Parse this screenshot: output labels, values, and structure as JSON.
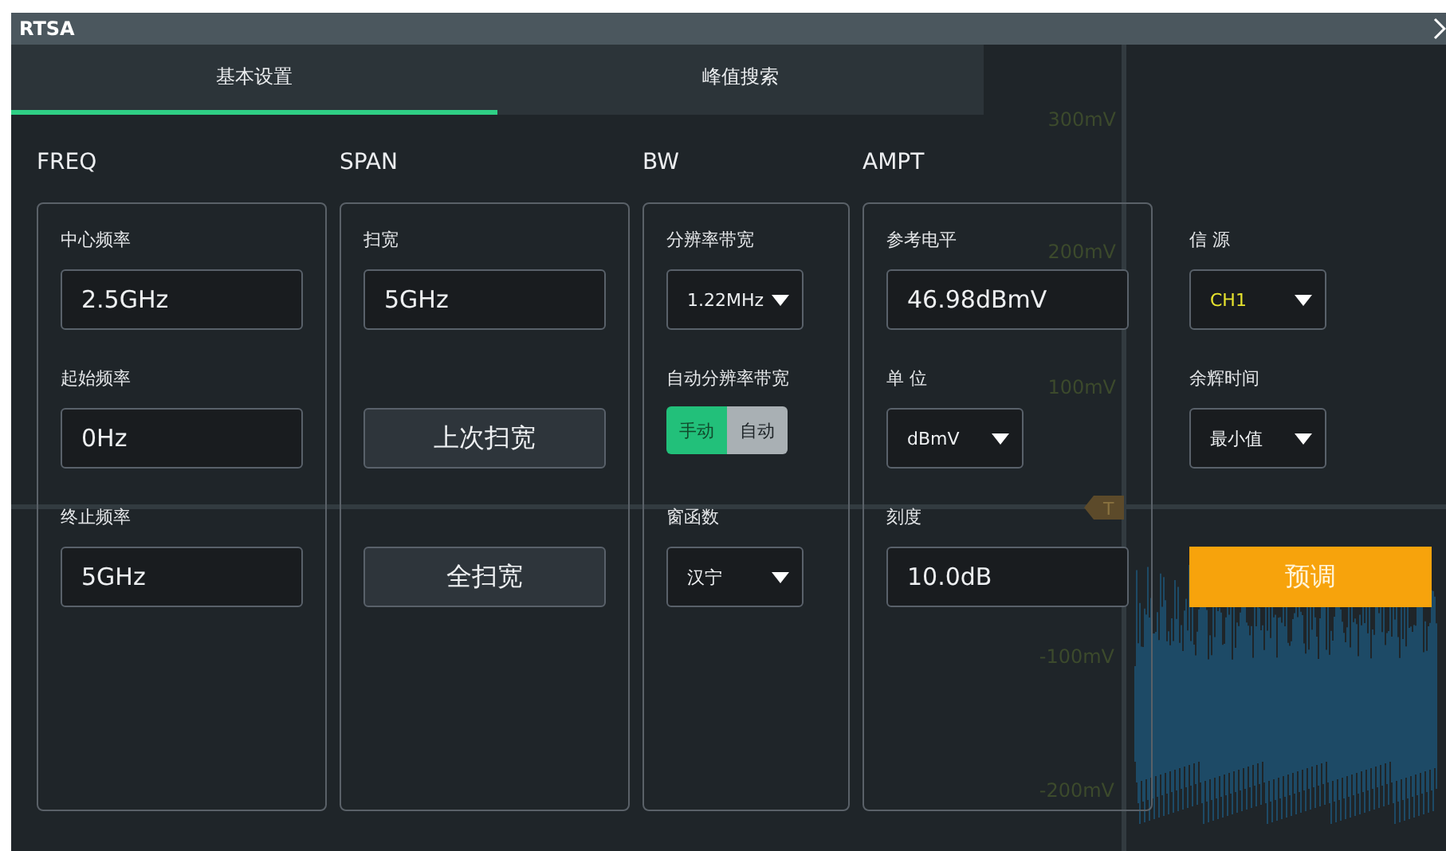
{
  "window": {
    "title": "RTSA"
  },
  "tabs": [
    {
      "label": "基本设置",
      "selected": true
    },
    {
      "label": "峰值搜索",
      "selected": false
    }
  ],
  "sections": [
    {
      "title": "FREQ",
      "fields": [
        {
          "kind": "input",
          "label": "中心频率",
          "value": "2.5GHz"
        },
        {
          "kind": "input",
          "label": "起始频率",
          "value": "0Hz"
        },
        {
          "kind": "input",
          "label": "终止频率",
          "value": "5GHz"
        }
      ]
    },
    {
      "title": "SPAN",
      "fields": [
        {
          "kind": "input",
          "label": "扫宽",
          "value": "5GHz"
        },
        {
          "kind": "button",
          "label": "上次扫宽"
        },
        {
          "kind": "button",
          "label": "全扫宽"
        }
      ]
    },
    {
      "title": "BW",
      "fields": [
        {
          "kind": "dropdown",
          "label": "分辨率带宽",
          "value": "1.22MHz"
        },
        {
          "kind": "toggle",
          "label": "自动分辨率带宽",
          "options": [
            {
              "label": "手动",
              "selected": true
            },
            {
              "label": "自动",
              "selected": false
            }
          ]
        },
        {
          "kind": "dropdown",
          "label": "窗函数",
          "value": "汉宁"
        }
      ]
    },
    {
      "title": "AMPT",
      "fields": [
        {
          "kind": "input",
          "label": "参考电平",
          "value": "46.98dBmV"
        },
        {
          "kind": "dropdown",
          "label": "单 位",
          "value": "dBmV"
        },
        {
          "kind": "input",
          "label": "刻度",
          "value": "10.0dB"
        }
      ]
    }
  ],
  "side_panel": {
    "fields": [
      {
        "kind": "dropdown",
        "label": "信 源",
        "value": "CH1",
        "color": "#e6e22e"
      },
      {
        "kind": "dropdown",
        "label": "余辉时间",
        "value": "最小值"
      },
      {
        "kind": "primary",
        "label": "预调"
      }
    ]
  },
  "scope": {
    "axis_labels": [
      "300mV",
      "200mV",
      "100mV",
      "-100mV",
      "-200mV"
    ],
    "trigger_marker": "T"
  }
}
